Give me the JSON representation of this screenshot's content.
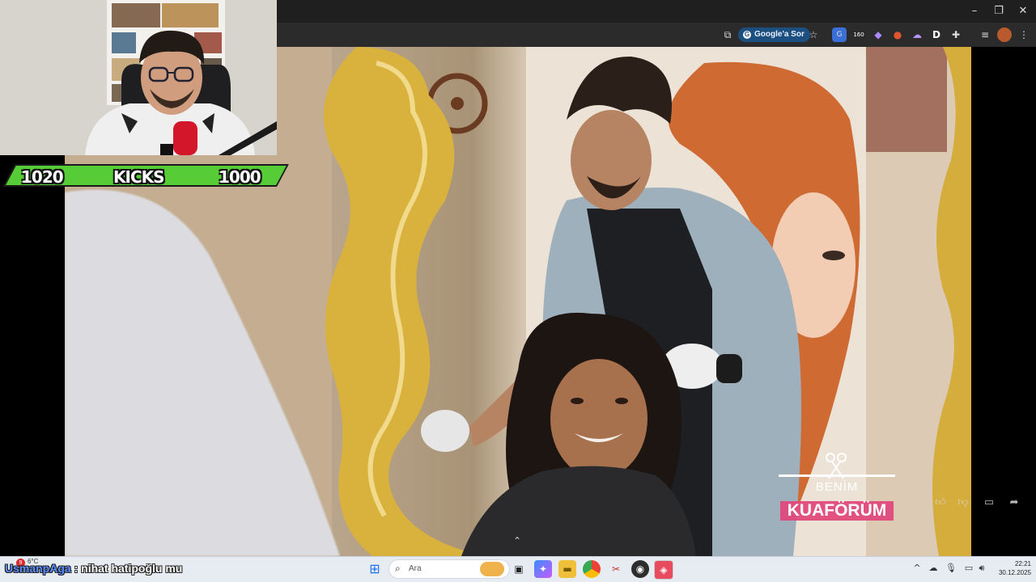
{
  "browser": {
    "google_ask_label": "Google'a Sor",
    "toolbar_badge": "160",
    "profile_letter": "D",
    "window_controls": [
      "minimize-icon",
      "restore-icon",
      "close-icon"
    ]
  },
  "stream_overlay": {
    "kicks_left": "1020",
    "kicks_label": "KICKS",
    "kicks_right": "1000"
  },
  "video": {
    "logo_line1": "BENİM",
    "logo_line2": "KUAFÖRÜM"
  },
  "chat": {
    "username": "UsmanpAga",
    "separator": " : ",
    "message": "nihat hatipoğlu mu"
  },
  "taskbar": {
    "search_placeholder": "Ara",
    "weather_temp": "6°C",
    "notification_count": "9",
    "time": "22:21",
    "date": "30.12.2025",
    "icons": [
      "windows-start-icon",
      "search-icon",
      "widgets-icon",
      "task-view-icon",
      "copilot-icon",
      "file-explorer-icon",
      "chrome-icon",
      "snipping-tool-icon",
      "obs-icon",
      "browser-app-icon"
    ]
  },
  "colors": {
    "kicks_green": "#56cc36",
    "chat_username": "#5a8cff",
    "logo_pink": "#e0457a",
    "browser_chip": "#1b4f80"
  }
}
